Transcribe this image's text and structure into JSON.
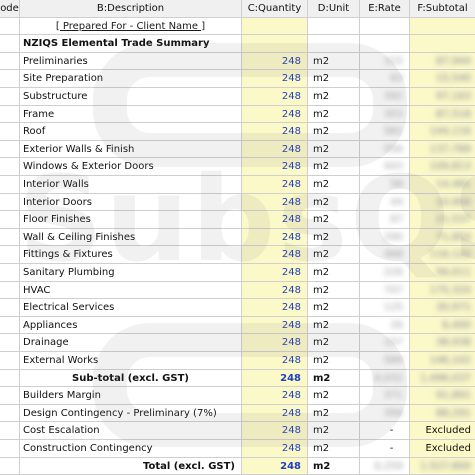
{
  "columns": [
    "ode",
    "B:Description",
    "C:Quantity",
    "D:Unit",
    "E:Rate",
    "F:Subtotal"
  ],
  "title_row": {
    "text": "[ Prepared For - Client Name ]"
  },
  "section_title": "NZIQS Elemental Trade Summary",
  "items": [
    {
      "desc": "Preliminaries",
      "qty": "248",
      "unit": "m2",
      "rate": "315",
      "subtotal": "87,944"
    },
    {
      "desc": "Site Preparation",
      "qty": "248",
      "unit": "m2",
      "rate": "63",
      "subtotal": "15,540"
    },
    {
      "desc": "Substructure",
      "qty": "248",
      "unit": "m2",
      "rate": "392",
      "subtotal": "97,163"
    },
    {
      "desc": "Frame",
      "qty": "248",
      "unit": "m2",
      "rate": "353",
      "subtotal": "87,518"
    },
    {
      "desc": "Roof",
      "qty": "248",
      "unit": "m2",
      "rate": "581",
      "subtotal": "144,116"
    },
    {
      "desc": "Exterior Walls & Finish",
      "qty": "248",
      "unit": "m2",
      "rate": "556",
      "subtotal": "137,789"
    },
    {
      "desc": "Windows & Exterior Doors",
      "qty": "248",
      "unit": "m2",
      "rate": "443",
      "subtotal": "109,813"
    },
    {
      "desc": "Interior Walls",
      "qty": "248",
      "unit": "m2",
      "rate": "58",
      "subtotal": "14,481"
    },
    {
      "desc": "Interior Doors",
      "qty": "248",
      "unit": "m2",
      "rate": "44",
      "subtotal": "10,900"
    },
    {
      "desc": "Floor Finishes",
      "qty": "248",
      "unit": "m2",
      "rate": "87",
      "subtotal": "21,537"
    },
    {
      "desc": "Wall & Ceiling Finishes",
      "qty": "248",
      "unit": "m2",
      "rate": "290",
      "subtotal": "71,854"
    },
    {
      "desc": "Fittings & Fixtures",
      "qty": "248",
      "unit": "m2",
      "rate": "468",
      "subtotal": "116,120"
    },
    {
      "desc": "Sanitary Plumbing",
      "qty": "248",
      "unit": "m2",
      "rate": "226",
      "subtotal": "56,011"
    },
    {
      "desc": "HVAC",
      "qty": "248",
      "unit": "m2",
      "rate": "707",
      "subtotal": "175,320"
    },
    {
      "desc": "Electrical Services",
      "qty": "248",
      "unit": "m2",
      "rate": "125",
      "subtotal": "30,971"
    },
    {
      "desc": "Appliances",
      "qty": "248",
      "unit": "m2",
      "rate": "26",
      "subtotal": "6,400"
    },
    {
      "desc": "Drainage",
      "qty": "248",
      "unit": "m2",
      "rate": "157",
      "subtotal": "38,938"
    },
    {
      "desc": "External Works",
      "qty": "248",
      "unit": "m2",
      "rate": "589",
      "subtotal": "146,102"
    }
  ],
  "subtotal_row": {
    "label": "Sub-total (excl. GST)",
    "qty": "248",
    "unit": "m2",
    "rate": "6,032",
    "subtotal": "1,496,037"
  },
  "extras": [
    {
      "desc": "Builders Margin",
      "qty": "248",
      "unit": "m2",
      "rate": "371",
      "subtotal": "91,891",
      "rate_blur": true,
      "subtotal_blur": true
    },
    {
      "desc": "Design Contingency - Preliminary (7%)",
      "qty": "248",
      "unit": "m2",
      "rate": "356",
      "subtotal": "88,291",
      "rate_blur": true,
      "subtotal_blur": true
    },
    {
      "desc": "Cost Escalation",
      "qty": "248",
      "unit": "m2",
      "rate": "-",
      "subtotal": "Excluded",
      "rate_blur": false,
      "subtotal_blur": false
    },
    {
      "desc": "Construction Contingency",
      "qty": "248",
      "unit": "m2",
      "rate": "-",
      "subtotal": "Excluded",
      "rate_blur": false,
      "subtotal_blur": false
    }
  ],
  "total_row": {
    "label": "Total (excl. GST)",
    "qty": "248",
    "unit": "m2",
    "rate": "6,259",
    "subtotal": "1,527,800"
  },
  "watermark": "SubsQS",
  "colors": {
    "highlight": "#fbf9c7",
    "quantity_text": "#1f3fbf",
    "header_bg": "#f0f0f0",
    "grid": "#cfcfcf"
  }
}
